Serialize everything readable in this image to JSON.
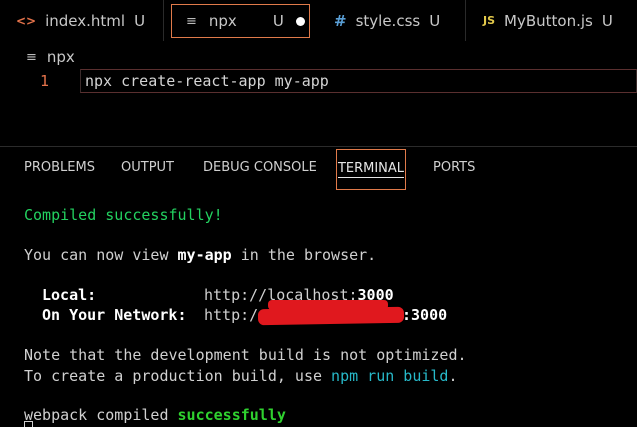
{
  "tabs": [
    {
      "icon": "<>",
      "label": "index.html",
      "status": "U"
    },
    {
      "icon": "≡",
      "label": "npx",
      "status": "U"
    },
    {
      "icon": "#",
      "label": "style.css",
      "status": "U"
    },
    {
      "icon": "JS",
      "label": "MyButton.js",
      "status": "U"
    }
  ],
  "breadcrumb": {
    "icon": "≡",
    "label": "npx"
  },
  "editor": {
    "line_number": "1",
    "code": "npx create-react-app my-app"
  },
  "panel_tabs": [
    "PROBLEMS",
    "OUTPUT",
    "DEBUG CONSOLE",
    "TERMINAL",
    "PORTS"
  ],
  "terminal": {
    "compiled": "Compiled successfully!",
    "view_prefix": "You can now view ",
    "app_name": "my-app",
    "view_suffix": " in the browser.",
    "local_label": "Local:",
    "local_url_prefix": "http://localhost:",
    "local_port": "3000",
    "network_label": "On Your Network:",
    "network_url_prefix": "http:/",
    "network_port_suffix": ":3000",
    "note_line1": "Note that the development build is not optimized.",
    "note_line2_prefix": "To create a production build, use ",
    "note_cmd": "npm run build",
    "note_line2_suffix": ".",
    "webpack_prefix": "webpack compiled ",
    "webpack_status": "successfully"
  },
  "colors": {
    "accent_border": "#e07a4a",
    "success": "#23d160",
    "link": "#27b9c9",
    "redaction": "#e0181e"
  }
}
